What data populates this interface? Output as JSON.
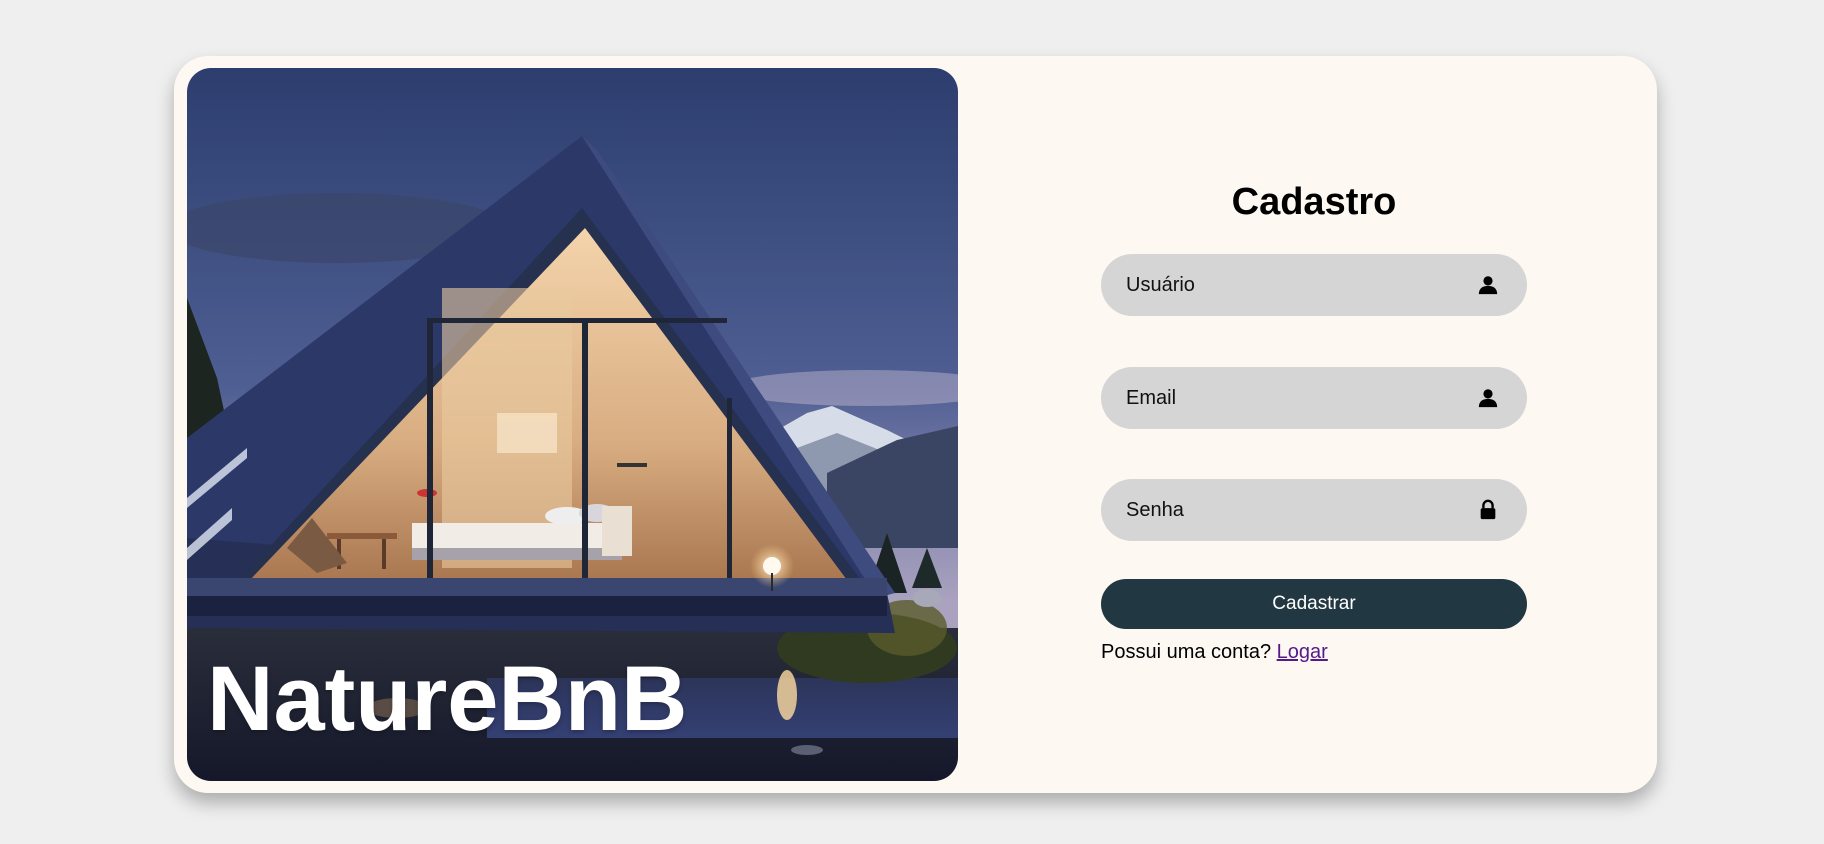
{
  "brand": {
    "name": "NatureBnB"
  },
  "form": {
    "title": "Cadastro",
    "fields": [
      {
        "placeholder": "Usuário",
        "icon": "user-icon"
      },
      {
        "placeholder": "Email",
        "icon": "user-icon"
      },
      {
        "placeholder": "Senha",
        "icon": "lock-icon"
      }
    ],
    "submit_label": "Cadastrar",
    "login_prompt": "Possui uma conta?",
    "login_link": "Logar"
  },
  "colors": {
    "page_background": "#efefef",
    "card_background": "#fdf8f2",
    "field_background": "#d5d5d5",
    "button_background": "#213843",
    "link_color": "#551a8b"
  }
}
